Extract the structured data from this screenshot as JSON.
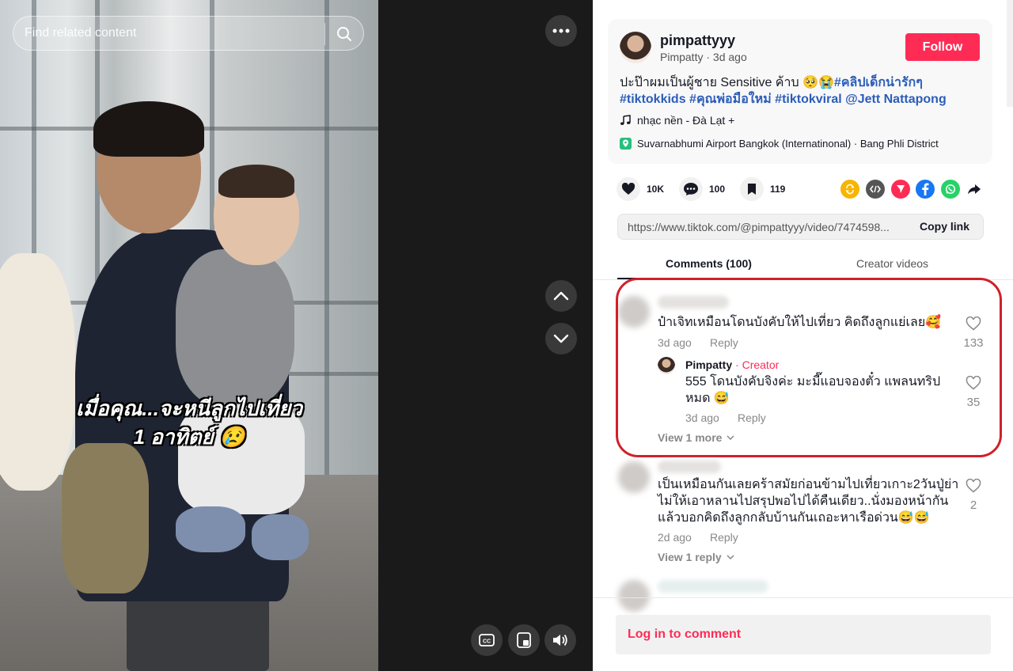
{
  "search": {
    "placeholder": "Find related content"
  },
  "video": {
    "overlay_line1": "เมื่อคุณ...จะหนีลูกไปเที่ยว",
    "overlay_line2": "1 อาทิตย์ 😢"
  },
  "author": {
    "username": "pimpattyyy",
    "display_name": "Pimpatty",
    "posted": "3d ago",
    "follow_label": "Follow"
  },
  "description": {
    "text": "ปะป๊าผมเป็นผู้ชาย Sensitive ค้าบ 🥺😭",
    "hashtags": [
      "#คลิปเด็กน่ารักๆ",
      "#tiktokkids",
      "#คุณพ่อมือใหม่",
      "#tiktokviral",
      "@Jett Nattapong"
    ]
  },
  "music": "nhạc nền - Đà Lạt +",
  "location": "Suvarnabhumi Airport Bangkok (Internatinonal) · Bang Phli District",
  "stats": {
    "likes": "10K",
    "comments": "100",
    "saves": "119"
  },
  "share_icons": [
    "repost-icon",
    "embed-icon",
    "send-icon",
    "facebook-icon",
    "whatsapp-icon",
    "share-arrow-icon"
  ],
  "share_colors": {
    "repost": "#f7b500",
    "embed": "#555555",
    "send": "#fe2c55",
    "facebook": "#1877f2",
    "whatsapp": "#25d366",
    "accent": "#fe2c55",
    "hashtag": "#2b5db9",
    "creator": "#fe2c55"
  },
  "link": {
    "url": "https://www.tiktok.com/@pimpattyyy/video/7474598...",
    "copy_label": "Copy link"
  },
  "tabs": {
    "comments": "Comments (100)",
    "creator_videos": "Creator videos"
  },
  "comments": [
    {
      "text": "ป๋าเจิทเหมือนโดนบังคับให้ไปเที่ยว คิดถึงลูกแย่เลย🥰",
      "time": "3d ago",
      "reply_label": "Reply",
      "likes": "133",
      "reply": {
        "name": "Pimpatty",
        "tag": "Creator",
        "text": "555 โดนบังคับจิงค่ะ มะมี๊แอบจองตั๋ว แพลนทริปหมด 😅",
        "time": "3d ago",
        "reply_label": "Reply",
        "likes": "35"
      },
      "view_more": "View 1 more"
    },
    {
      "text": "เป็นเหมือนกันเลยคร้าสมัยก่อนข้ามไปเที่ยวเกาะ2วันปู่ย่าไม่ให้เอาหลานไปสรุปพอไปได้คืนเดียว..นั่งมองหน้ากันแล้วบอกคิดถึงลูกกลับบ้านกันเถอะหาเรือด่วน😅😅",
      "time": "2d ago",
      "reply_label": "Reply",
      "likes": "2",
      "view_more": "View 1 reply"
    }
  ],
  "login": {
    "label": "Log in to comment"
  },
  "controls": {
    "separator": "·"
  }
}
